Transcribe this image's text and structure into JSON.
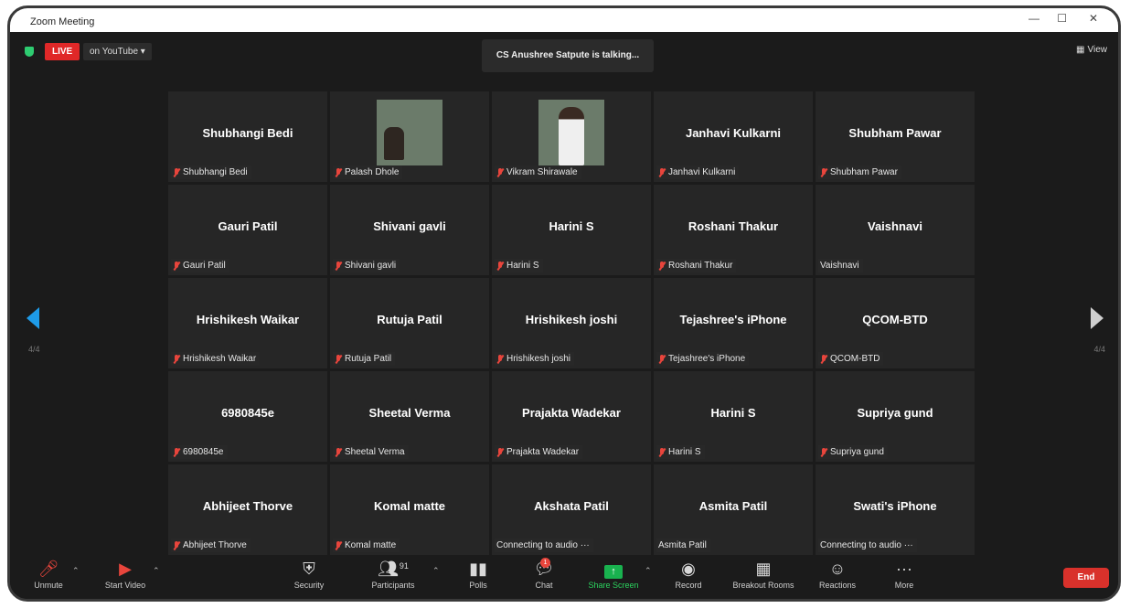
{
  "window": {
    "title": "Zoom Meeting",
    "minimize": "—",
    "maximize": "☐",
    "close": "✕"
  },
  "top": {
    "live_label": "LIVE",
    "stream_label": "on YouTube ▾",
    "talking": "CS Anushree Satpute is talking...",
    "view_label": "View"
  },
  "pager": {
    "left": "4/4",
    "right": "4/4"
  },
  "participants": [
    {
      "big": "Shubhangi Bedi",
      "label": "Shubhangi Bedi",
      "muted": true,
      "photo": ""
    },
    {
      "big": "",
      "label": "Palash Dhole",
      "muted": true,
      "photo": "landscape"
    },
    {
      "big": "",
      "label": "Vikram Shirawale",
      "muted": true,
      "photo": "person"
    },
    {
      "big": "Janhavi Kulkarni",
      "label": "Janhavi Kulkarni",
      "muted": true,
      "photo": ""
    },
    {
      "big": "Shubham Pawar",
      "label": "Shubham Pawar",
      "muted": true,
      "photo": ""
    },
    {
      "big": "Gauri Patil",
      "label": "Gauri Patil",
      "muted": true,
      "photo": ""
    },
    {
      "big": "Shivani gavli",
      "label": "Shivani gavli",
      "muted": true,
      "photo": ""
    },
    {
      "big": "Harini S",
      "label": "Harini S",
      "muted": true,
      "photo": ""
    },
    {
      "big": "Roshani Thakur",
      "label": "Roshani Thakur",
      "muted": true,
      "photo": ""
    },
    {
      "big": "Vaishnavi",
      "label": "Vaishnavi",
      "muted": false,
      "photo": ""
    },
    {
      "big": "Hrishikesh Waikar",
      "label": "Hrishikesh Waikar",
      "muted": true,
      "photo": ""
    },
    {
      "big": "Rutuja Patil",
      "label": "Rutuja Patil",
      "muted": true,
      "photo": ""
    },
    {
      "big": "Hrishikesh joshi",
      "label": "Hrishikesh joshi",
      "muted": true,
      "photo": ""
    },
    {
      "big": "Tejashree's iPhone",
      "label": "Tejashree's iPhone",
      "muted": true,
      "photo": ""
    },
    {
      "big": "QCOM-BTD",
      "label": "QCOM-BTD",
      "muted": true,
      "photo": ""
    },
    {
      "big": "6980845e",
      "label": "6980845e",
      "muted": true,
      "photo": ""
    },
    {
      "big": "Sheetal Verma",
      "label": "Sheetal Verma",
      "muted": true,
      "photo": ""
    },
    {
      "big": "Prajakta Wadekar",
      "label": "Prajakta Wadekar",
      "muted": true,
      "photo": ""
    },
    {
      "big": "Harini S",
      "label": "Harini S",
      "muted": true,
      "photo": ""
    },
    {
      "big": "Supriya gund",
      "label": "Supriya gund",
      "muted": true,
      "photo": ""
    },
    {
      "big": "Abhijeet Thorve",
      "label": "Abhijeet Thorve",
      "muted": true,
      "photo": ""
    },
    {
      "big": "Komal matte",
      "label": "Komal matte",
      "muted": true,
      "photo": ""
    },
    {
      "big": "Akshata Patil",
      "label": "Connecting to audio ···",
      "muted": false,
      "photo": ""
    },
    {
      "big": "Asmita Patil",
      "label": "Asmita Patil",
      "muted": false,
      "photo": ""
    },
    {
      "big": "Swati's iPhone",
      "label": "Connecting to audio ···",
      "muted": false,
      "photo": ""
    }
  ],
  "toolbar": {
    "unmute": "Unmute",
    "start_video": "Start Video",
    "security": "Security",
    "participants": "Participants",
    "participants_count": "91",
    "polls": "Polls",
    "chat": "Chat",
    "chat_badge": "1",
    "share_screen": "Share Screen",
    "record": "Record",
    "breakout_rooms": "Breakout Rooms",
    "reactions": "Reactions",
    "more": "More",
    "end": "End"
  },
  "colors": {
    "live": "#e02828",
    "share": "#2bd35e",
    "end": "#d9312b",
    "nav_left": "#1e9be8"
  }
}
